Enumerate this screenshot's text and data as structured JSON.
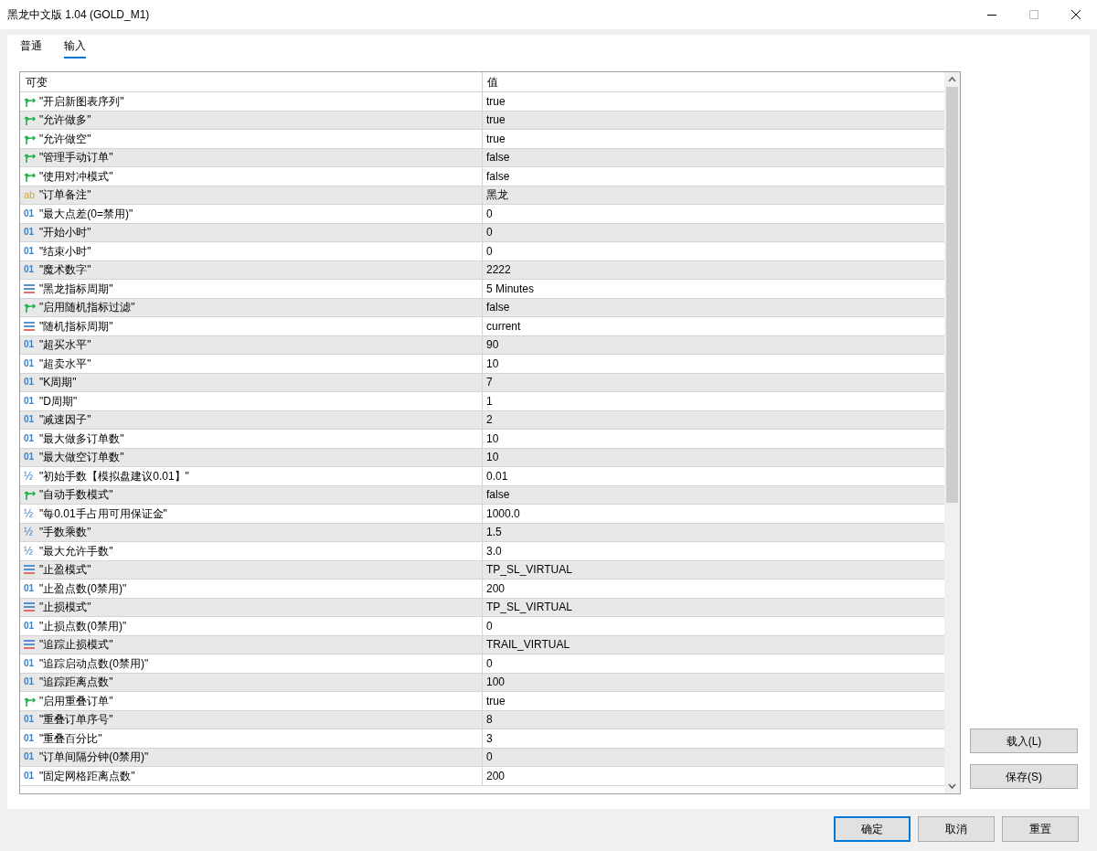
{
  "window": {
    "title": "黑龙中文版 1.04 (GOLD_M1)"
  },
  "tabs": [
    {
      "label": "普通",
      "selected": false
    },
    {
      "label": "输入",
      "selected": true
    }
  ],
  "table": {
    "columns": [
      "可变",
      "值"
    ],
    "rows": [
      {
        "kind": "bool",
        "name": "\"开启新图表序列\"",
        "value": "true"
      },
      {
        "kind": "bool",
        "name": "\"允许做多\"",
        "value": "true"
      },
      {
        "kind": "bool",
        "name": "\"允许做空\"",
        "value": "true"
      },
      {
        "kind": "bool",
        "name": "\"管理手动订单\"",
        "value": "false"
      },
      {
        "kind": "bool",
        "name": "\"使用对冲模式\"",
        "value": "false"
      },
      {
        "kind": "string",
        "icon": "ab",
        "name": "\"订单备注\"",
        "value": "黑龙"
      },
      {
        "kind": "int",
        "icon": "01",
        "name": "\"最大点差(0=禁用)\"",
        "value": "0"
      },
      {
        "kind": "int",
        "icon": "01",
        "name": "\"开始小时\"",
        "value": "0"
      },
      {
        "kind": "int",
        "icon": "01",
        "name": "\"结束小时\"",
        "value": "0"
      },
      {
        "kind": "int",
        "icon": "01",
        "name": "\"魔术数字\"",
        "value": "2222"
      },
      {
        "kind": "enum",
        "name": "\"黑龙指标周期\"",
        "value": "5 Minutes"
      },
      {
        "kind": "bool",
        "name": "\"启用随机指标过滤\"",
        "value": "false"
      },
      {
        "kind": "enum",
        "name": "\"随机指标周期\"",
        "value": "current"
      },
      {
        "kind": "int",
        "icon": "01",
        "name": "\"超买水平\"",
        "value": "90"
      },
      {
        "kind": "int",
        "icon": "01",
        "name": "\"超卖水平\"",
        "value": "10"
      },
      {
        "kind": "int",
        "icon": "01",
        "name": "\"K周期\"",
        "value": "7"
      },
      {
        "kind": "int",
        "icon": "01",
        "name": "\"D周期\"",
        "value": "1"
      },
      {
        "kind": "int",
        "icon": "01",
        "name": "\"减速因子\"",
        "value": "2"
      },
      {
        "kind": "int",
        "icon": "01",
        "name": "\"最大做多订单数\"",
        "value": "10"
      },
      {
        "kind": "int",
        "icon": "01",
        "name": "\"最大做空订单数\"",
        "value": "10"
      },
      {
        "kind": "double",
        "icon": "½",
        "name": "\"初始手数【模拟盘建议0.01】\"",
        "value": "0.01"
      },
      {
        "kind": "bool",
        "name": "\"自动手数模式\"",
        "value": "false"
      },
      {
        "kind": "double",
        "icon": "½",
        "name": "\"每0.01手占用可用保证金\"",
        "value": "1000.0"
      },
      {
        "kind": "double",
        "icon": "½",
        "name": "\"手数乘数\"",
        "value": "1.5"
      },
      {
        "kind": "double",
        "icon": "½",
        "name": "\"最大允许手数\"",
        "value": "3.0"
      },
      {
        "kind": "enum",
        "name": "\"止盈模式\"",
        "value": "TP_SL_VIRTUAL"
      },
      {
        "kind": "int",
        "icon": "01",
        "name": "\"止盈点数(0禁用)\"",
        "value": "200"
      },
      {
        "kind": "enum",
        "name": "\"止损模式\"",
        "value": "TP_SL_VIRTUAL"
      },
      {
        "kind": "int",
        "icon": "01",
        "name": "\"止损点数(0禁用)\"",
        "value": "0"
      },
      {
        "kind": "enum",
        "name": "\"追踪止损模式\"",
        "value": "TRAIL_VIRTUAL"
      },
      {
        "kind": "int",
        "icon": "01",
        "name": "\"追踪启动点数(0禁用)\"",
        "value": "0"
      },
      {
        "kind": "int",
        "icon": "01",
        "name": "\"追踪距离点数\"",
        "value": "100"
      },
      {
        "kind": "bool",
        "name": "\"启用重叠订单\"",
        "value": "true"
      },
      {
        "kind": "int",
        "icon": "01",
        "name": "\"重叠订单序号\"",
        "value": "8"
      },
      {
        "kind": "int",
        "icon": "01",
        "name": "\"重叠百分比\"",
        "value": "3"
      },
      {
        "kind": "int",
        "icon": "01",
        "name": "\"订单间隔分钟(0禁用)\"",
        "value": "0"
      },
      {
        "kind": "int",
        "icon": "01",
        "name": "\"固定网格距离点数\"",
        "value": "200"
      }
    ]
  },
  "side_buttons": [
    "载入(L)",
    "保存(S)"
  ],
  "footer_buttons": [
    {
      "label": "确定",
      "selected": true
    },
    {
      "label": "取消",
      "selected": false
    },
    {
      "label": "重置",
      "selected": false
    }
  ]
}
